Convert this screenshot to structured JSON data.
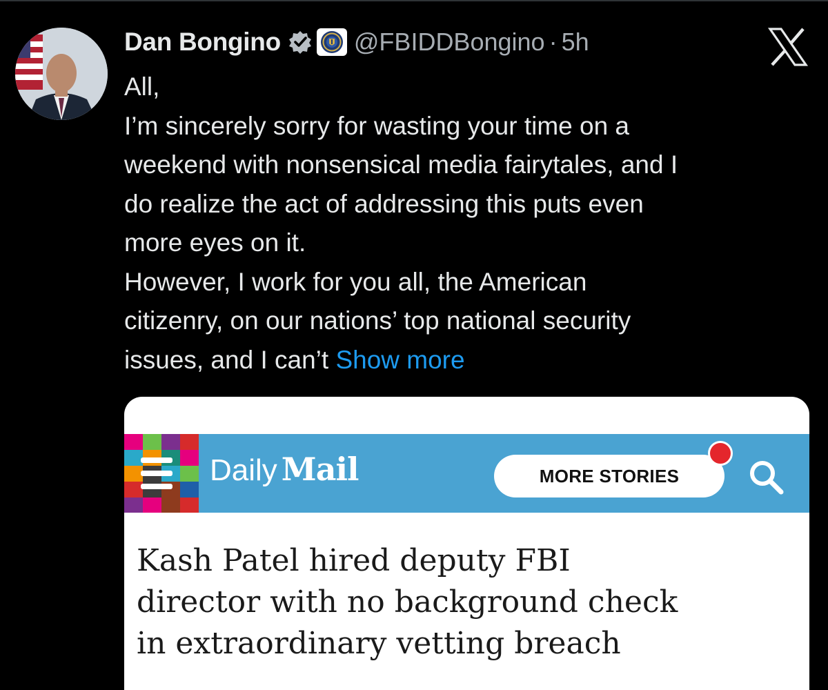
{
  "tweet": {
    "author": {
      "display_name": "Dan Bongino",
      "handle": "@FBIDDBongino",
      "separator": "·",
      "time": "5h",
      "verified_icon": "verified-badge-icon",
      "affiliation_icon": "fbi-seal-icon"
    },
    "text_lines": [
      "All,",
      "I’m sincerely sorry for wasting your time on a",
      "weekend with nonsensical media fairytales, and I",
      "do realize the act of addressing this puts even",
      "more eyes on it.",
      "However, I work for you all, the American",
      "citizenry, on our nations’ top national security",
      "issues, and I can’t "
    ],
    "show_more_label": "Show more"
  },
  "card": {
    "logo_daily": "Daily",
    "logo_mail": "Mail",
    "more_stories_label": "MORE STORIES",
    "headline_lines": [
      "Kash Patel hired deputy FBI",
      "director with no background check",
      "in extraordinary vetting breach"
    ]
  },
  "colors": {
    "background": "#000000",
    "text": "#e7e9ea",
    "secondary_text": "#a7adb3",
    "link": "#1d9bf0",
    "dailymail_bar": "#4aa3d2",
    "notification_dot": "#e4262c"
  }
}
